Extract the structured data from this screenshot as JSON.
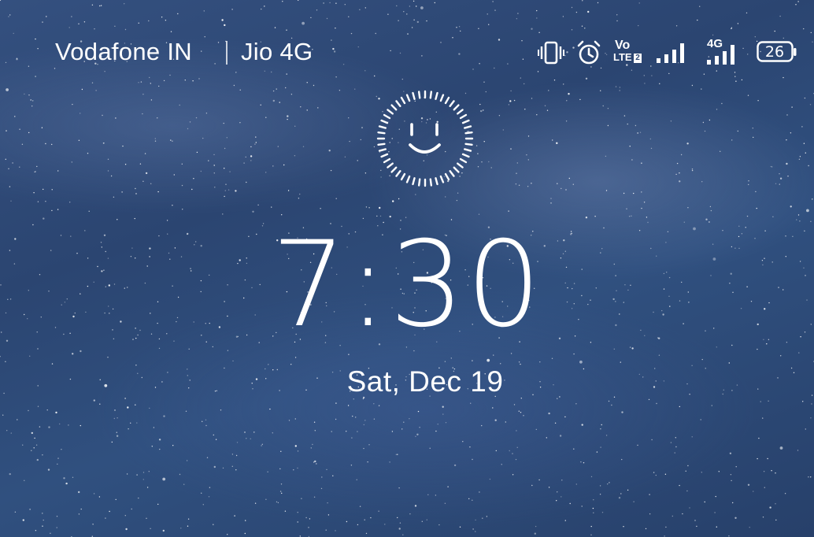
{
  "status_bar": {
    "carrier_1": "Vodafone IN",
    "carrier_2": "Jio 4G",
    "battery_level": "26",
    "network_label": "4G",
    "volte_label": "Vo",
    "lte_label": "LTE",
    "lte_slot": "2",
    "icons": [
      "vibrate-icon",
      "alarm-icon",
      "volte-icon",
      "signal-icon",
      "signal-4g-icon",
      "battery-icon"
    ]
  },
  "face_unlock": {
    "icon": "face-unlock-icon"
  },
  "clock": {
    "time": "7:30"
  },
  "date": {
    "text": "Sat, Dec 19"
  },
  "colors": {
    "foreground": "#ffffff",
    "background": "#2e4a78"
  }
}
